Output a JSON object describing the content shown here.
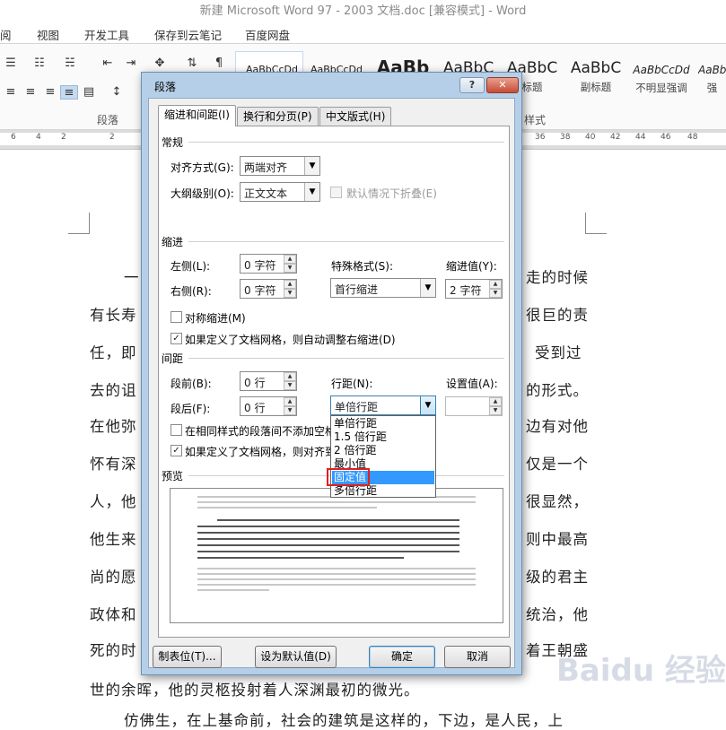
{
  "window": {
    "title": "新建 Microsoft Word 97 - 2003 文档.doc [兼容模式] - Word"
  },
  "menu": [
    "阅",
    "视图",
    "开发工具",
    "保存到云笔记",
    "百度网盘"
  ],
  "ribbon": {
    "styles": [
      {
        "sample": "AaBbCcDd",
        "name": ""
      },
      {
        "sample": "AaBbCcDd",
        "name": ""
      },
      {
        "sample": "AaBb",
        "name": ""
      },
      {
        "sample": "AaBbC",
        "name": ""
      },
      {
        "sample": "AaBbC",
        "name": "标题"
      },
      {
        "sample": "AaBbC",
        "name": "副标题"
      },
      {
        "sample": "AaBbCcDd",
        "name": "不明显强调"
      },
      {
        "sample": "AaBb",
        "name": "强"
      }
    ],
    "group_paragraph": "段落",
    "group_styles": "样式"
  },
  "ruler_ticks": [
    "6",
    "4",
    "2",
    "2",
    "36",
    "38",
    "40",
    "42",
    "44",
    "46",
    "48"
  ],
  "document": {
    "lines": [
      {
        "left": "一",
        "right": "走的时候"
      },
      {
        "left": "有长寿",
        "right": "很巨的责"
      },
      {
        "left": "任，即",
        "right": "受到过"
      },
      {
        "left": "去的诅",
        "right": "的形式。"
      },
      {
        "left": "在他弥",
        "right": "边有对他"
      },
      {
        "left": "怀有深",
        "right": "仅是一个"
      },
      {
        "left": "人，他",
        "right": "很显然，"
      },
      {
        "left": "他生来",
        "right": "则中最高"
      },
      {
        "left": "尚的愿",
        "right": "级的君主"
      },
      {
        "left": "政体和",
        "right": "统治，他"
      },
      {
        "left": "死的时",
        "right": "着王朝盛"
      },
      {
        "left": "世的余晖，他的灵柩投射着人深渊最初的微光。",
        "right": ""
      },
      {
        "left": "仿佛生，在上基命前，社会的建筑是这样的，下边，是人民，上",
        "right": ""
      }
    ]
  },
  "dialog": {
    "title": "段落",
    "help": "?",
    "close": "✕",
    "tabs": [
      "缩进和间距(I)",
      "换行和分页(P)",
      "中文版式(H)"
    ],
    "general": {
      "section": "常规",
      "alignment_label": "对齐方式(G):",
      "alignment_value": "两端对齐",
      "outline_label": "大纲级别(O):",
      "outline_value": "正文文本",
      "collapse_label": "默认情况下折叠(E)"
    },
    "indent": {
      "section": "缩进",
      "left_label": "左侧(L):",
      "left_value": "0 字符",
      "right_label": "右侧(R):",
      "right_value": "0 字符",
      "special_label": "特殊格式(S):",
      "special_value": "首行缩进",
      "by_label": "缩进值(Y):",
      "by_value": "2 字符",
      "mirror_label": "对称缩进(M)",
      "auto_adjust_label": "如果定义了文档网格，则自动调整右缩进(D)"
    },
    "spacing": {
      "section": "间距",
      "before_label": "段前(B):",
      "before_value": "0 行",
      "after_label": "段后(F):",
      "after_value": "0 行",
      "line_spacing_label": "行距(N):",
      "line_spacing_value": "单倍行距",
      "at_label": "设置值(A):",
      "at_value": "",
      "no_space_label": "在相同样式的段落间不添加空格",
      "snap_grid_label": "如果定义了文档网格，则对齐到",
      "line_spacing_options": [
        "单倍行距",
        "1.5 倍行距",
        "2 倍行距",
        "最小值",
        "固定值",
        "多倍行距"
      ],
      "highlighted_option": "固定值"
    },
    "preview": {
      "section": "预览"
    },
    "buttons": {
      "tabs": "制表位(T)...",
      "set_default": "设为默认值(D)",
      "ok": "确定",
      "cancel": "取消"
    }
  },
  "watermark": "Baidu 经验"
}
